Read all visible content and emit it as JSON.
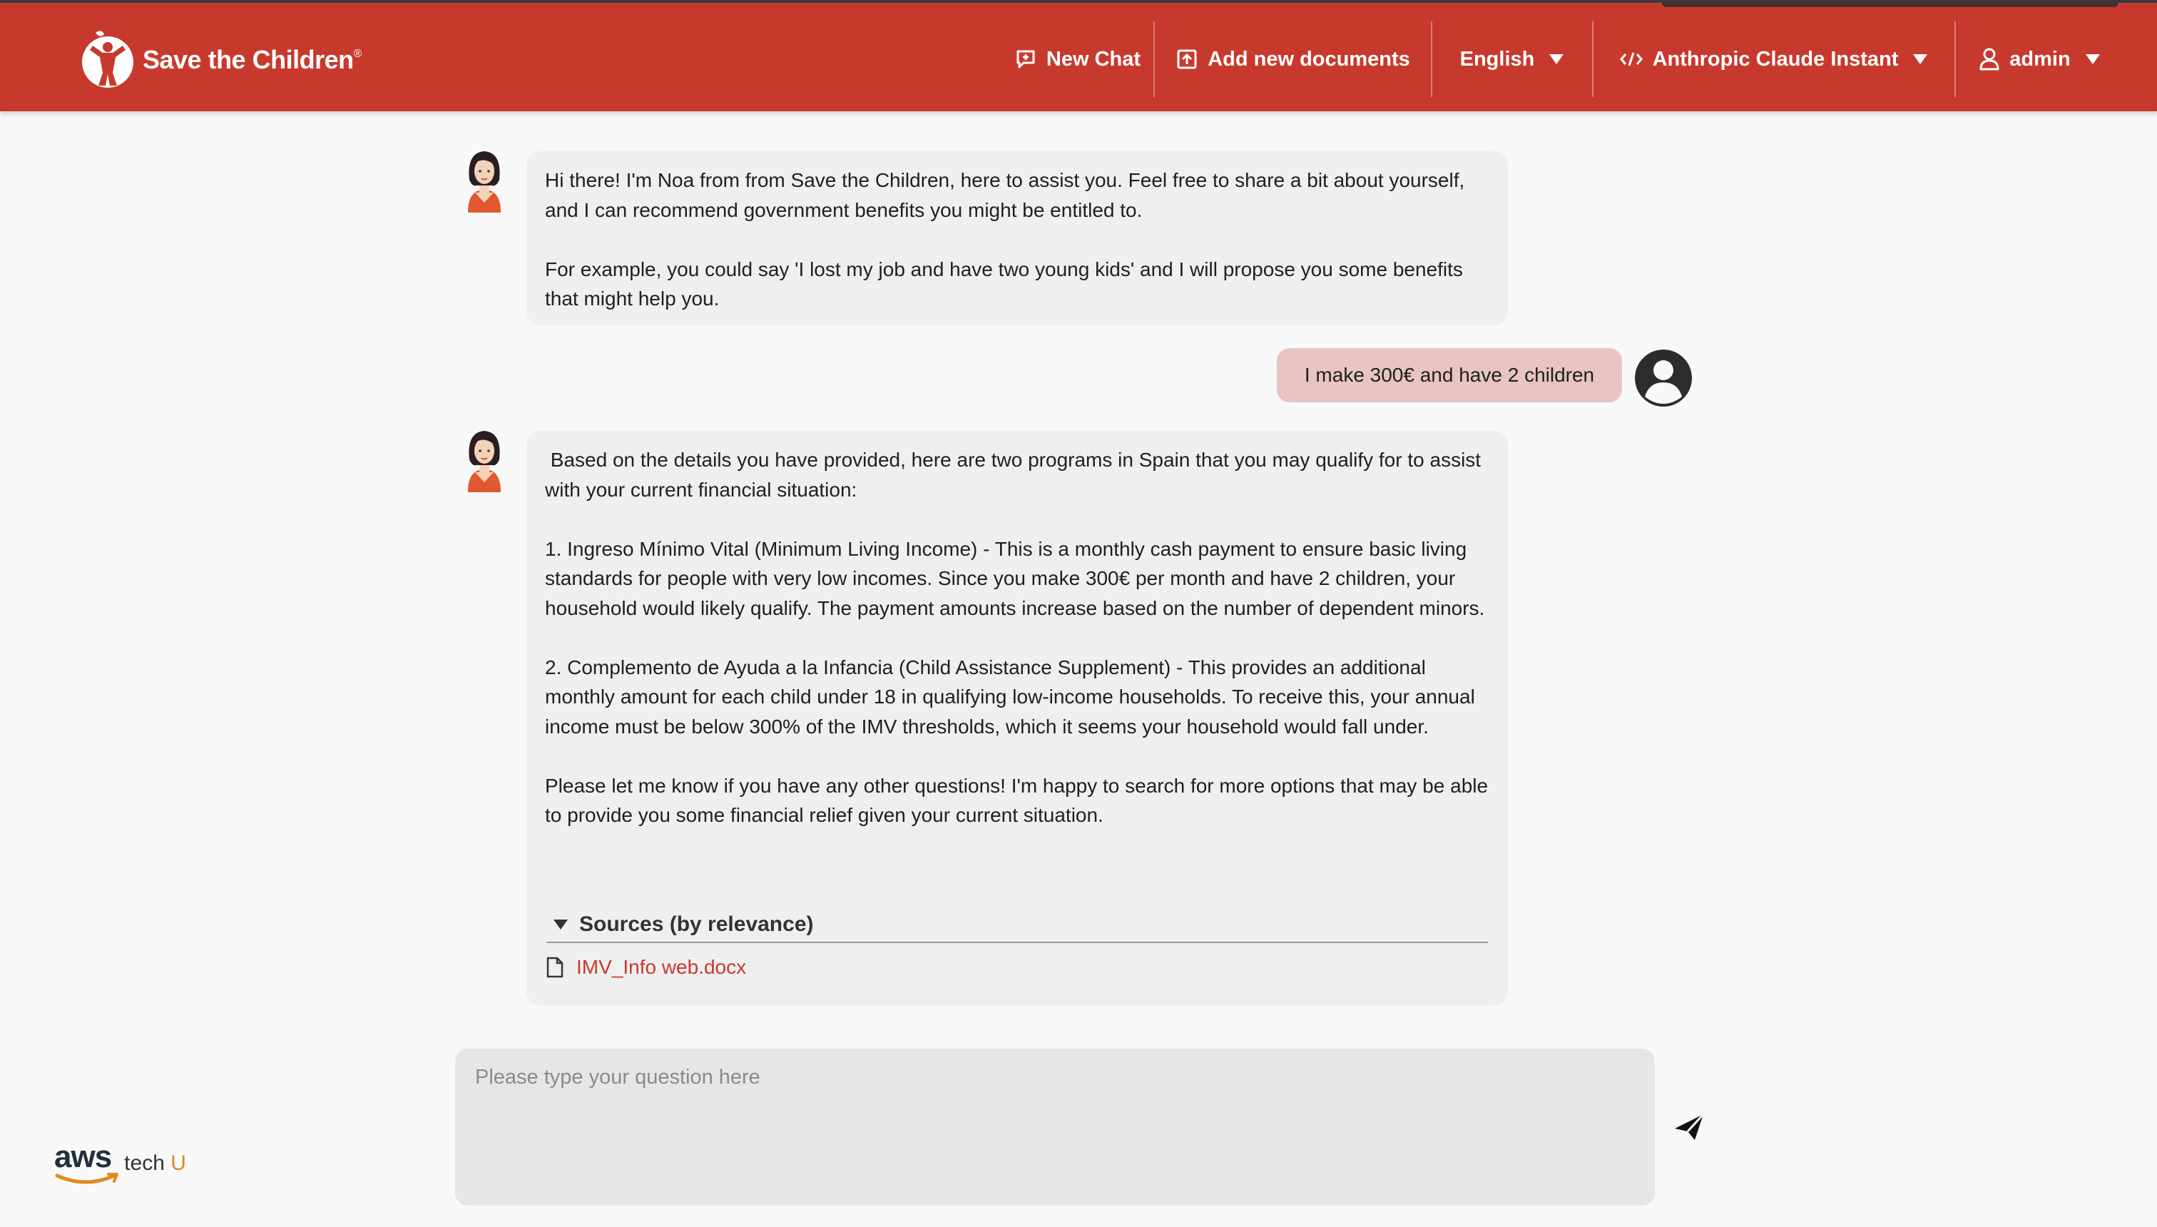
{
  "brand": {
    "name": "Save the Children",
    "registered_mark": "®",
    "primary_color": "#c8392d",
    "link_color": "#c8392d"
  },
  "nav": {
    "new_chat": {
      "label": "New Chat",
      "icon": "chat-plus-icon"
    },
    "add_documents": {
      "label": "Add new documents",
      "icon": "upload-icon"
    },
    "language": {
      "label": "English",
      "icon": "chevron-down-icon"
    },
    "model": {
      "label": "Anthropic Claude Instant",
      "icon": "code-icon"
    },
    "user": {
      "label": "admin",
      "icon": "user-icon"
    }
  },
  "messages": [
    {
      "role": "assistant",
      "paragraphs": [
        "Hi there! I'm Noa from from Save the Children, here to assist you. Feel free to share a bit about yourself, and I can recommend government benefits you might be entitled to.",
        "For example, you could say 'I lost my job and have two young kids' and I will propose you some benefits that might help you."
      ]
    },
    {
      "role": "user",
      "text": "I make 300€ and have 2 children"
    },
    {
      "role": "assistant",
      "paragraphs": [
        " Based on the details you have provided, here are two programs in Spain that you may qualify for to assist with your current financial situation:",
        "1. Ingreso Mínimo Vital (Minimum Living Income) - This is a monthly cash payment to ensure basic living standards for people with very low incomes. Since you make 300€ per month and have 2 children, your household would likely qualify. The payment amounts increase based on the number of dependent minors.",
        "2. Complemento de Ayuda a la Infancia (Child Assistance Supplement) - This provides an additional monthly amount for each child under 18 in qualifying low-income households. To receive this, your annual income must be below 300% of the IMV thresholds, which it seems your household would fall under.",
        "Please let me know if you have any other questions! I'm happy to search for more options that may be able to provide you some financial relief given your current situation."
      ],
      "sources": {
        "label": "Sources (by relevance)",
        "items": [
          "IMV_Info web.docx"
        ]
      }
    }
  ],
  "composer": {
    "placeholder": "Please type your question here",
    "send_icon": "send-icon"
  },
  "footer": {
    "aws_word": "aws",
    "tech_label": "tech ",
    "tech_u": "U"
  }
}
